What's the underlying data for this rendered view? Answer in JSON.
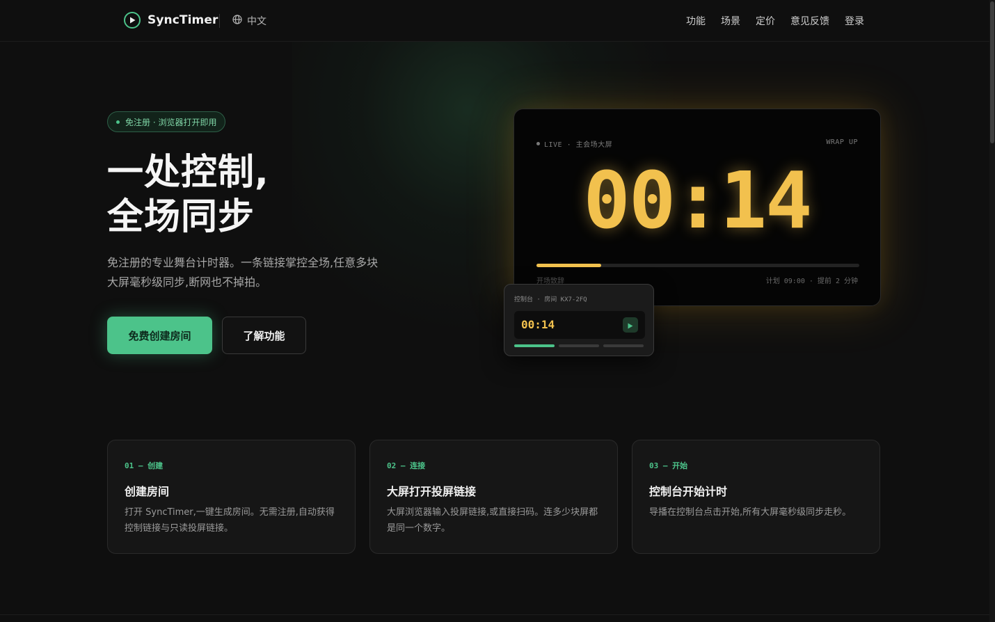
{
  "header": {
    "brand": "SyncTimer",
    "language": "中文",
    "nav": [
      "功能",
      "场景",
      "定价",
      "意见反馈",
      "登录"
    ]
  },
  "hero": {
    "badge": "免注册 · 浏览器打开即用",
    "title_line1": "一处控制,",
    "title_line2": "全场同步",
    "desc_line1": "免注册的专业舞台计时器。一条链接掌控全场,任意多块",
    "desc_line2": "大屏毫秒级同步,断网也不掉拍。",
    "primary_button": "免费创建房间",
    "secondary_button": "了解功能"
  },
  "display": {
    "status": "LIVE · 主会场大屏",
    "state": "WRAP UP",
    "time": "00:14",
    "progress": 0.2,
    "segment": "开场致辞",
    "plan": "计划 09:00 · 提前 2 分钟"
  },
  "controller": {
    "header": "控制台 · 房间 KX7-2FQ",
    "time": "00:14",
    "segments": 3,
    "active_segment": 1
  },
  "steps": [
    {
      "num": "01 — 创建",
      "title": "创建房间",
      "desc": "打开 SyncTimer,一键生成房间。无需注册,自动获得控制链接与只读投屏链接。"
    },
    {
      "num": "02 — 连接",
      "title": "大屏打开投屏链接",
      "desc": "大屏浏览器输入投屏链接,或直接扫码。连多少块屏都是同一个数字。"
    },
    {
      "num": "03 — 开始",
      "title": "控制台开始计时",
      "desc": "导播在控制台点击开始,所有大屏毫秒级同步走秒。"
    }
  ],
  "colors": {
    "accent": "#4cc38a",
    "timer": "#f2c14e",
    "background": "#0f0f0f"
  },
  "icons": [
    "logo-play-icon",
    "globe-icon",
    "play-icon"
  ]
}
